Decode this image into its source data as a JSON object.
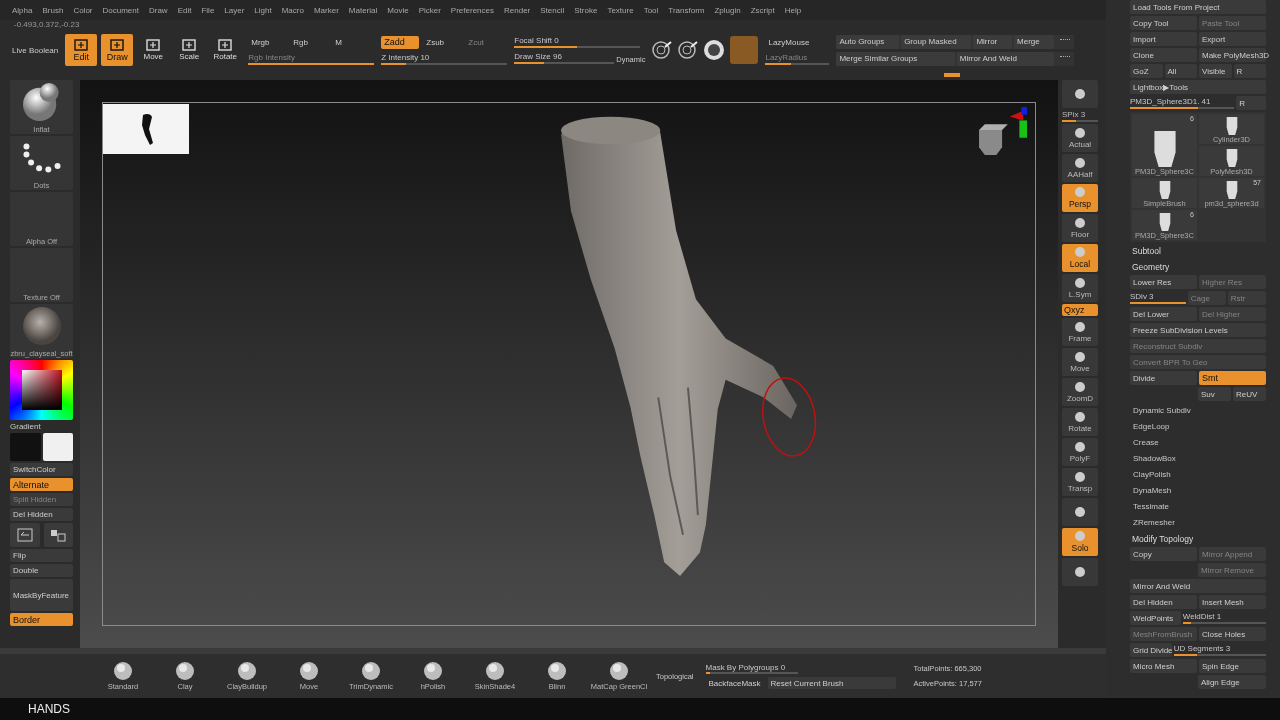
{
  "menu_bar": [
    "Alpha",
    "Brush",
    "Color",
    "Document",
    "Draw",
    "Edit",
    "File",
    "Layer",
    "Light",
    "Macro",
    "Marker",
    "Material",
    "Movie",
    "Picker",
    "Preferences",
    "Render",
    "Stencil",
    "Stroke",
    "Texture",
    "Tool",
    "Transform",
    "Zplugin",
    "Zscript",
    "Help"
  ],
  "coordinates": "-0.493,0.372,-0.23",
  "top_shelf": {
    "label": "Live Boolean",
    "mode_buttons": [
      {
        "label": "Edit",
        "on": true,
        "disabled": false
      },
      {
        "label": "Draw",
        "on": true,
        "disabled": false
      },
      {
        "label": "Move",
        "on": false,
        "disabled": false
      },
      {
        "label": "Scale",
        "on": false,
        "disabled": false
      },
      {
        "label": "Rotate",
        "on": false,
        "disabled": false
      }
    ],
    "color_buttons": [
      {
        "label": "Mrgb",
        "on": false,
        "disabled": false
      },
      {
        "label": "Rgb",
        "on": false,
        "disabled": false
      },
      {
        "label": "M",
        "on": false,
        "disabled": false
      }
    ],
    "rgb_intensity": {
      "label": "Rgb Intensity",
      "level": 1,
      "disabled": true
    },
    "z_buttons": [
      {
        "label": "Zadd",
        "on": true,
        "disabled": false
      },
      {
        "label": "Zsub",
        "on": false,
        "disabled": false
      },
      {
        "label": "Zcut",
        "on": false,
        "disabled": true
      }
    ],
    "z_intensity": {
      "label": "Z Intensity 10",
      "level": 0.2,
      "disabled": false
    },
    "focal_shift": {
      "label": "Focal Shift 0",
      "level": 0.5,
      "disabled": false
    },
    "draw_size": {
      "label": "Draw Size 96",
      "level": 0.3,
      "disabled": false
    },
    "dynamic": "Dynamic",
    "lazy_mouse": {
      "label": "LazyMouse",
      "on": false,
      "disabled": false
    },
    "lazy_radius": {
      "label": "LazyRadius",
      "level": 0.4,
      "disabled": true
    },
    "group_rows": [
      [
        {
          "label": "Auto Groups",
          "on": false,
          "disabled": false
        },
        {
          "label": "Group Masked",
          "on": false,
          "disabled": false
        },
        {
          "label": "Mirror",
          "on": false,
          "disabled": false
        },
        {
          "label": "Merge",
          "on": false,
          "disabled": false
        }
      ],
      [
        {
          "label": "Merge Similar Groups",
          "on": false,
          "disabled": false
        },
        {
          "label": "Mirror And Weld",
          "on": false,
          "disabled": false
        }
      ]
    ]
  },
  "left_shelf": {
    "brush": "Inflat",
    "stroke": "Dots",
    "alpha": "Alpha Off",
    "texture": "Texture Off",
    "material": "zbru_clayseal_soft",
    "gradient": "Gradient",
    "controls": [
      {
        "kind": "button",
        "label": "SwitchColor",
        "on": false,
        "disabled": false
      },
      {
        "kind": "button",
        "label": "Alternate",
        "on": true,
        "disabled": false
      },
      {
        "kind": "button",
        "label": "Split Hidden",
        "on": false,
        "disabled": true
      },
      {
        "kind": "button",
        "label": "Del Hidden",
        "on": false,
        "disabled": false
      },
      {
        "kind": "icons",
        "on": false,
        "disabled": false
      },
      {
        "kind": "button",
        "label": "Flip",
        "on": false,
        "disabled": false
      },
      {
        "kind": "button",
        "label": "Double",
        "on": false,
        "disabled": false
      },
      {
        "kind": "tall",
        "label": "MaskByFeature",
        "on": false,
        "disabled": false
      },
      {
        "kind": "button",
        "label": "Border",
        "on": true,
        "disabled": false
      }
    ]
  },
  "right_shelf": [
    {
      "kind": "icon",
      "on": false
    },
    {
      "kind": "slider",
      "label": "SPix 3",
      "level": 0.4
    },
    {
      "kind": "icon",
      "label": "Actual",
      "on": false
    },
    {
      "kind": "icon",
      "label": "AAHalf",
      "on": false
    },
    {
      "kind": "icon",
      "label": "Persp",
      "on": true
    },
    {
      "kind": "icon",
      "label": "Floor",
      "on": false
    },
    {
      "kind": "icon",
      "label": "Local",
      "on": true
    },
    {
      "kind": "icon",
      "label": "L.Sym",
      "on": false
    },
    {
      "kind": "small",
      "label": "Qxyz",
      "on": true
    },
    {
      "kind": "icon",
      "label": "Frame",
      "on": false
    },
    {
      "kind": "icon",
      "label": "Move",
      "on": false
    },
    {
      "kind": "icon",
      "label": "ZoomD",
      "on": false
    },
    {
      "kind": "icon",
      "label": "Rotate",
      "on": false
    },
    {
      "kind": "icon",
      "label": "PolyF",
      "on": false
    },
    {
      "kind": "icon",
      "label": "Transp",
      "on": false
    },
    {
      "kind": "dim",
      "on": false
    },
    {
      "kind": "icon",
      "label": "Solo",
      "on": true
    },
    {
      "kind": "icon",
      "on": false
    }
  ],
  "tool_panel": {
    "top_rows": [
      {
        "cells": [
          {
            "kind": "button",
            "label": "Load Tools From Project",
            "on": false,
            "disabled": false
          }
        ]
      },
      {
        "cells": [
          {
            "kind": "button",
            "label": "Copy Tool",
            "on": false,
            "disabled": false
          },
          {
            "kind": "button",
            "label": "Paste Tool",
            "on": false,
            "disabled": true
          }
        ]
      },
      {
        "cells": [
          {
            "kind": "button",
            "label": "Import",
            "on": false,
            "disabled": false
          },
          {
            "kind": "button",
            "label": "Export",
            "on": false,
            "disabled": false
          }
        ]
      },
      {
        "cells": [
          {
            "kind": "button",
            "label": "Clone",
            "on": false,
            "disabled": false
          },
          {
            "kind": "button",
            "label": "Make PolyMesh3D",
            "on": false,
            "disabled": false
          }
        ]
      },
      {
        "cells": [
          {
            "kind": "button",
            "label": "GoZ",
            "on": false,
            "disabled": false
          },
          {
            "kind": "button",
            "label": "All",
            "on": false,
            "disabled": false
          },
          {
            "kind": "button",
            "label": "Visible",
            "on": false,
            "disabled": false
          },
          {
            "kind": "button",
            "label": "R",
            "on": false,
            "disabled": false
          }
        ]
      },
      {
        "cells": [
          {
            "kind": "button",
            "label": "Lightbox▶Tools",
            "on": false,
            "disabled": false
          }
        ]
      },
      {
        "cells": [
          {
            "kind": "slider",
            "label": "PM3D_Sphere3D1. 41",
            "level": 0.65,
            "disabled": false
          },
          {
            "kind": "button",
            "label": "R",
            "on": false,
            "disabled": false
          }
        ]
      }
    ],
    "tools": [
      {
        "label": "PM3D_Sphere3C",
        "count": "6",
        "kind": "large"
      },
      {
        "label": "Cylinder3D",
        "kind": "small"
      },
      {
        "label": "PolyMesh3D",
        "kind": "small"
      },
      {
        "label": "SimpleBrush",
        "kind": "small"
      },
      {
        "label": "pm3d_sphere3d",
        "count": "57",
        "kind": "small"
      },
      {
        "label": "PM3D_Sphere3C",
        "count": "6",
        "kind": "small"
      }
    ],
    "rows": [
      {
        "cells": [
          {
            "kind": "header",
            "label": "Subtool"
          }
        ]
      },
      {
        "cells": [
          {
            "kind": "header",
            "label": "Geometry"
          }
        ]
      },
      {
        "cells": [
          {
            "kind": "button",
            "label": "Lower Res",
            "on": false,
            "disabled": false
          },
          {
            "kind": "button",
            "label": "Higher Res",
            "on": false,
            "disabled": true
          }
        ]
      },
      {
        "cells": [
          {
            "kind": "slider",
            "label": "SDiv 3",
            "level": 1,
            "disabled": false
          },
          {
            "kind": "button",
            "label": "Cage",
            "on": false,
            "disabled": true
          },
          {
            "kind": "button",
            "label": "Rstr",
            "on": false,
            "disabled": true
          }
        ]
      },
      {
        "cells": [
          {
            "kind": "button",
            "label": "Del Lower",
            "on": false,
            "disabled": false
          },
          {
            "kind": "button",
            "label": "Del Higher",
            "on": false,
            "disabled": true
          }
        ]
      },
      {
        "cells": [
          {
            "kind": "button",
            "label": "Freeze SubDivision Levels",
            "on": false,
            "disabled": false
          }
        ]
      },
      {
        "cells": [
          {
            "kind": "button",
            "label": "Reconstruct Subdiv",
            "on": false,
            "disabled": true
          }
        ]
      },
      {
        "cells": [
          {
            "kind": "button",
            "label": "Convert BPR To Geo",
            "on": false,
            "disabled": true
          }
        ]
      },
      {
        "cells": [
          {
            "kind": "button",
            "label": "Divide",
            "on": false,
            "disabled": false
          },
          {
            "kind": "button",
            "label": "Smt",
            "on": true,
            "disabled": false
          }
        ]
      },
      {
        "indent": true,
        "cells": [
          {
            "kind": "button",
            "label": "Suv",
            "on": false,
            "disabled": false
          },
          {
            "kind": "button",
            "label": "ReUV",
            "on": false,
            "disabled": false
          }
        ]
      },
      {
        "cells": [
          {
            "kind": "section",
            "label": "Dynamic Subdiv"
          }
        ]
      },
      {
        "cells": [
          {
            "kind": "section",
            "label": "EdgeLoop"
          }
        ]
      },
      {
        "cells": [
          {
            "kind": "section",
            "label": "Crease"
          }
        ]
      },
      {
        "cells": [
          {
            "kind": "section",
            "label": "ShadowBox"
          }
        ]
      },
      {
        "cells": [
          {
            "kind": "section",
            "label": "ClayPolish"
          }
        ]
      },
      {
        "cells": [
          {
            "kind": "section",
            "label": "DynaMesh"
          }
        ]
      },
      {
        "cells": [
          {
            "kind": "section",
            "label": "Tessimate"
          }
        ]
      },
      {
        "cells": [
          {
            "kind": "section",
            "label": "ZRemesher"
          }
        ]
      },
      {
        "cells": [
          {
            "kind": "header",
            "label": "Modify Topology"
          }
        ]
      },
      {
        "cells": [
          {
            "kind": "button",
            "label": "Copy",
            "on": false,
            "disabled": false
          },
          {
            "kind": "button",
            "label": "Mirror Append",
            "on": false,
            "disabled": true
          }
        ]
      },
      {
        "indent": true,
        "cells": [
          {
            "kind": "button",
            "label": "Mirror Remove",
            "on": false,
            "disabled": true
          }
        ]
      },
      {
        "cells": [
          {
            "kind": "button",
            "label": "Mirror And Weld",
            "on": false,
            "disabled": false
          }
        ]
      },
      {
        "cells": [
          {
            "kind": "button",
            "label": "Del Hidden",
            "on": false,
            "disabled": false
          },
          {
            "kind": "button",
            "label": "Insert Mesh",
            "on": false,
            "disabled": false
          }
        ]
      },
      {
        "cells": [
          {
            "kind": "button",
            "label": "WeldPoints",
            "on": false,
            "disabled": false
          },
          {
            "kind": "slider",
            "label": "WeldDist 1",
            "level": 0.1,
            "disabled": false
          }
        ]
      },
      {
        "cells": [
          {
            "kind": "button",
            "label": "MeshFromBrush",
            "on": false,
            "disabled": true
          },
          {
            "kind": "button",
            "label": "Close Holes",
            "on": false,
            "disabled": false
          }
        ]
      },
      {
        "cells": [
          {
            "kind": "button",
            "label": "Grid Divide",
            "on": false,
            "disabled": false
          },
          {
            "kind": "slider",
            "label": "UD Segments 3",
            "level": 0.25,
            "disabled": false
          }
        ]
      },
      {
        "cells": [
          {
            "kind": "button",
            "label": "Micro Mesh",
            "on": false,
            "disabled": false
          },
          {
            "kind": "button",
            "label": "Spin Edge",
            "on": false,
            "disabled": false
          }
        ]
      },
      {
        "indent": true,
        "cells": [
          {
            "kind": "button",
            "label": "Align Edge",
            "on": false,
            "disabled": false
          }
        ]
      }
    ]
  },
  "brush_bar": {
    "items": [
      "Standard",
      "Clay",
      "ClayBuildup",
      "Move",
      "TrimDynamic",
      "hPolish",
      "SkinShade4",
      "Blinn",
      "MatCap GreenCl"
    ],
    "topological": "Topological",
    "mask_by_polygroups": {
      "label": "Mask By Polygroups 0",
      "level": 0.05
    },
    "backface_mask": {
      "label": "BackfaceMask",
      "on": false,
      "disabled": false
    },
    "reset_brush": {
      "label": "Reset Current Brush",
      "on": false,
      "disabled": false
    },
    "total_points": "TotalPoints: 665,300",
    "active_points": "ActivePoints: 17,577"
  },
  "status_bar": {
    "title": "HANDS"
  }
}
